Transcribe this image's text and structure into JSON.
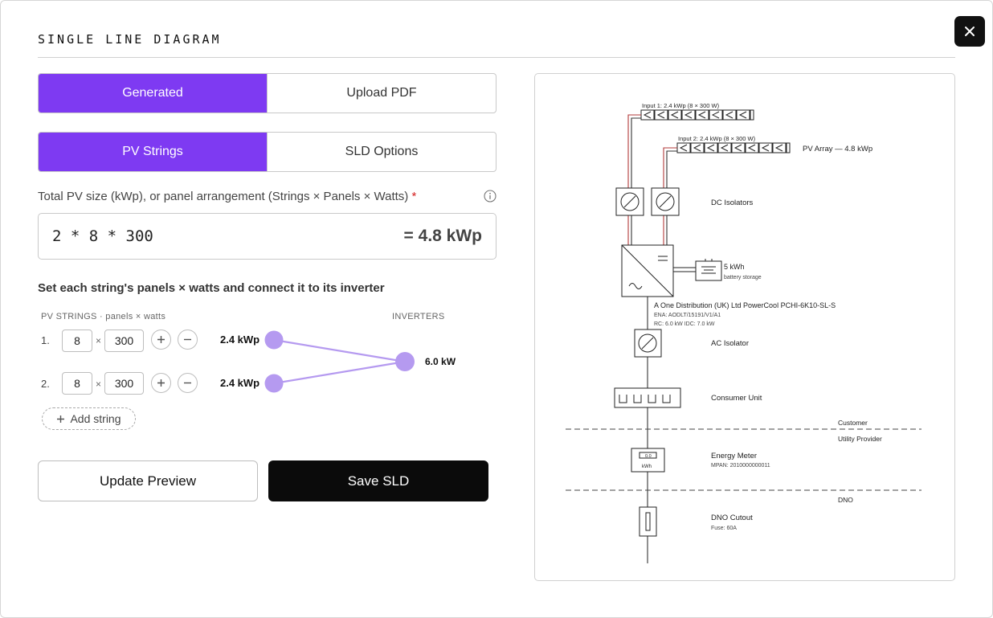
{
  "modal": {
    "title": "SINGLE LINE DIAGRAM",
    "close_icon": "close-icon"
  },
  "source_tabs": {
    "generated": "Generated",
    "upload": "Upload PDF",
    "active": "Generated"
  },
  "config_tabs": {
    "pv_strings": "PV Strings",
    "sld_options": "SLD Options",
    "active": "PV Strings"
  },
  "pv_size": {
    "label": "Total PV size (kWp), or panel arrangement (Strings × Panels × Watts)",
    "required_mark": "*",
    "value": "2 * 8 * 300",
    "result": "= 4.8 kWp"
  },
  "strings_section": {
    "heading": "Set each string's panels × watts and connect it to its inverter",
    "col_strings": "PV STRINGS · panels × watts",
    "col_inverters": "INVERTERS",
    "times": "×",
    "strings": [
      {
        "index": "1.",
        "panels": "8",
        "watts": "300",
        "kwp": "2.4 kWp"
      },
      {
        "index": "2.",
        "panels": "8",
        "watts": "300",
        "kwp": "2.4 kWp"
      }
    ],
    "inverter": {
      "kw": "6.0 kW"
    },
    "add_string": "Add string",
    "accent_color": "#b59af0"
  },
  "actions": {
    "update": "Update Preview",
    "save": "Save SLD"
  },
  "diagram": {
    "input1": "Input 1: 2.4 kWp (8 × 300 W)",
    "input2": "Input 2: 2.4 kWp (8 × 300 W)",
    "pv_array": "PV Array — 4.8 kWp",
    "dc_isolators": "DC Isolators",
    "battery_size": "5 kWh",
    "battery_label": "battery storage",
    "inverter_name": "A One Distribution (UK) Ltd PowerCool PCHI-6K10-SL-S",
    "inverter_ena": "ENA: AODLT/15191/V1/A1",
    "inverter_rc": "RC: 6.0 kW IDC: 7.0 kW",
    "ac_isolator": "AC Isolator",
    "consumer_unit": "Consumer Unit",
    "customer": "Customer",
    "utility": "Utility Provider",
    "meter_display": "0.0",
    "meter_unit": "kWh",
    "energy_meter": "Energy Meter",
    "mpan": "MPAN: 2010000000011",
    "dno": "DNO",
    "dno_cutout": "DNO Cutout",
    "fuse": "Fuse: 60A"
  }
}
